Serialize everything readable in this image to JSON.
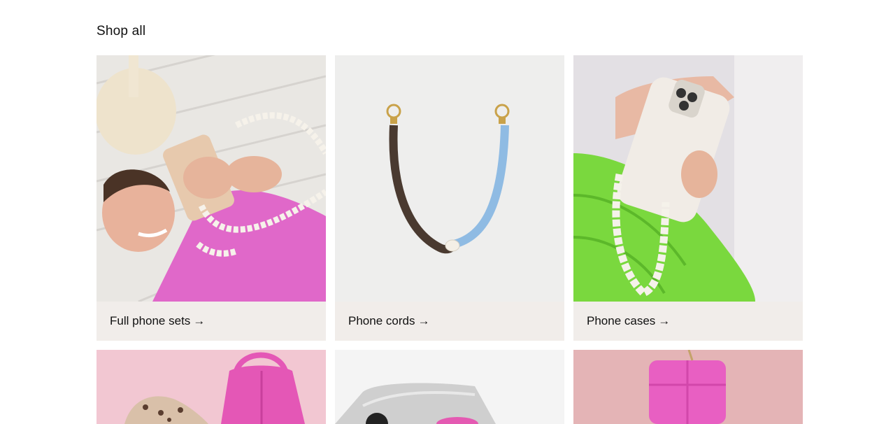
{
  "section": {
    "title": "Shop all"
  },
  "categories": [
    {
      "label": "Full phone sets",
      "arrow": "→"
    },
    {
      "label": "Phone cords",
      "arrow": "→"
    },
    {
      "label": "Phone cases",
      "arrow": "→"
    }
  ],
  "colors": {
    "caption_bg": "#f1edea",
    "text": "#111111"
  }
}
